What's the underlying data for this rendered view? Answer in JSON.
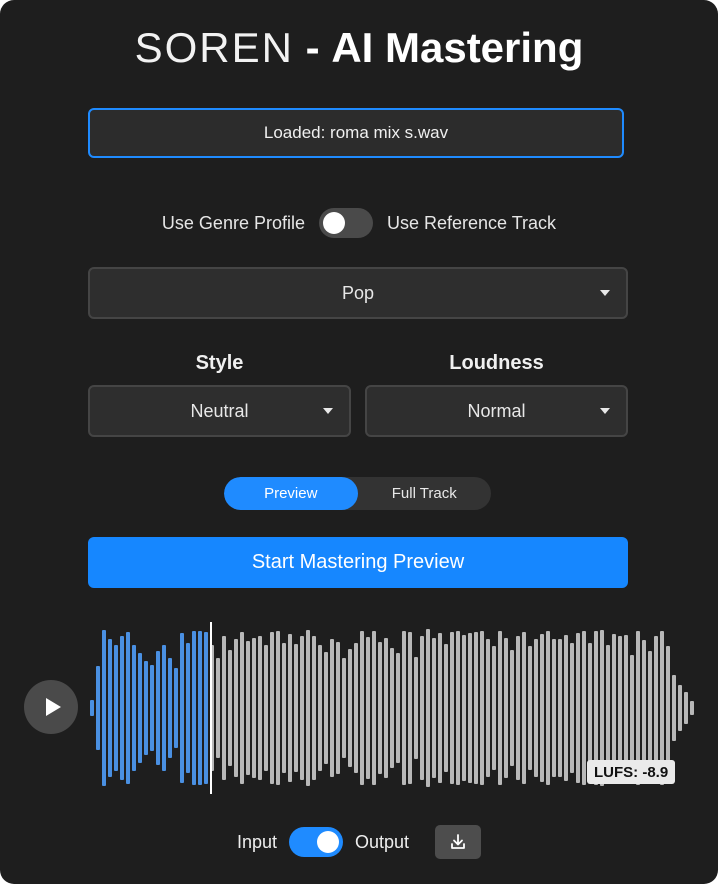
{
  "title": {
    "brand": "SOREN",
    "separator": "-",
    "product": "AI Mastering"
  },
  "file": {
    "status": "Loaded: roma mix s.wav"
  },
  "mode_toggle": {
    "left_label": "Use Genre Profile",
    "right_label": "Use Reference Track",
    "on": false
  },
  "genre": {
    "selected": "Pop"
  },
  "style": {
    "label": "Style",
    "selected": "Neutral"
  },
  "loudness": {
    "label": "Loudness",
    "selected": "Normal"
  },
  "preview_mode": {
    "options": [
      "Preview",
      "Full Track"
    ],
    "active_index": 0
  },
  "start_button": {
    "label": "Start Mastering Preview"
  },
  "waveform": {
    "played_fraction": 0.2,
    "played_color": "#4a90e2",
    "unplayed_color": "#b8b8b8",
    "amplitudes": [
      0.09,
      0.48,
      0.89,
      0.78,
      0.72,
      0.82,
      0.86,
      0.72,
      0.62,
      0.53,
      0.49,
      0.65,
      0.72,
      0.57,
      0.46,
      0.85,
      0.74,
      0.88,
      0.87,
      0.86,
      0.72,
      0.57,
      0.82,
      0.66,
      0.78,
      0.86,
      0.76,
      0.79,
      0.82,
      0.72,
      0.86,
      0.88,
      0.74,
      0.84,
      0.73,
      0.82,
      0.89,
      0.82,
      0.72,
      0.64,
      0.78,
      0.75,
      0.57,
      0.67,
      0.74,
      0.88,
      0.81,
      0.88,
      0.75,
      0.79,
      0.68,
      0.62,
      0.87,
      0.86,
      0.58,
      0.82,
      0.9,
      0.8,
      0.85,
      0.73,
      0.86,
      0.88,
      0.83,
      0.85,
      0.86,
      0.88,
      0.78,
      0.71,
      0.87,
      0.8,
      0.66,
      0.82,
      0.86,
      0.7,
      0.78,
      0.84,
      0.87,
      0.78,
      0.78,
      0.83,
      0.74,
      0.85,
      0.87,
      0.74,
      0.88,
      0.89,
      0.72,
      0.84,
      0.82,
      0.83,
      0.6,
      0.87,
      0.77,
      0.65,
      0.82,
      0.88,
      0.7,
      0.38,
      0.26,
      0.18,
      0.08
    ],
    "lufs_label": "LUFS: -8.9"
  },
  "io_toggle": {
    "left_label": "Input",
    "right_label": "Output",
    "on": true
  },
  "icons": {
    "play": "play-icon",
    "download": "download-icon",
    "caret": "caret-down-icon"
  },
  "colors": {
    "accent": "#1f8bff",
    "background": "#1e1e1e"
  }
}
